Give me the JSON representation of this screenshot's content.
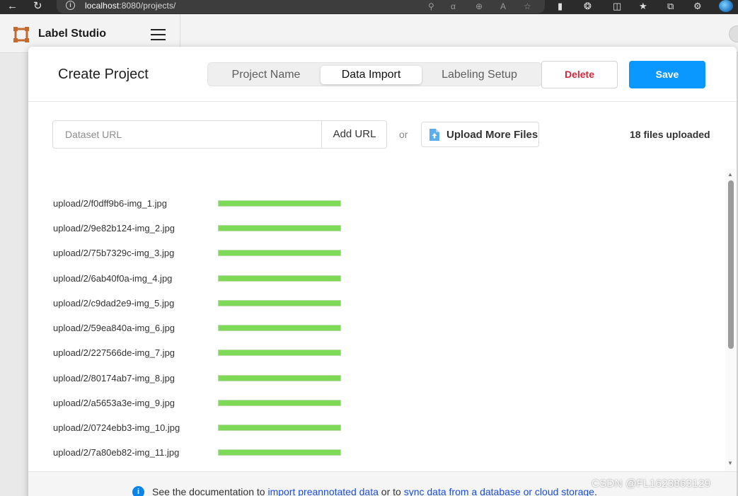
{
  "browser": {
    "back_icon": "back-arrow-icon",
    "reload_icon": "reload-icon",
    "url_host": "localhost",
    "url_path": ":8080/projects/"
  },
  "app": {
    "name": "Label Studio",
    "logo_color": "#c46a2e"
  },
  "modal": {
    "title": "Create Project",
    "tabs": [
      {
        "label": "Project Name",
        "active": false
      },
      {
        "label": "Data Import",
        "active": true
      },
      {
        "label": "Labeling Setup",
        "active": false
      }
    ],
    "delete_label": "Delete",
    "save_label": "Save",
    "accent_color": "#0a98ff",
    "delete_color": "#d9263c"
  },
  "import": {
    "url_placeholder": "Dataset URL",
    "add_url_label": "Add URL",
    "or_text": "or",
    "upload_label": "Upload More Files",
    "files_uploaded": "18 files uploaded"
  },
  "files": [
    {
      "name": "upload/2/f0dff9b6-img_1.jpg",
      "progress": 1.0
    },
    {
      "name": "upload/2/9e82b124-img_2.jpg",
      "progress": 1.0
    },
    {
      "name": "upload/2/75b7329c-img_3.jpg",
      "progress": 1.0
    },
    {
      "name": "upload/2/6ab40f0a-img_4.jpg",
      "progress": 1.0
    },
    {
      "name": "upload/2/c9dad2e9-img_5.jpg",
      "progress": 1.0
    },
    {
      "name": "upload/2/59ea840a-img_6.jpg",
      "progress": 1.0
    },
    {
      "name": "upload/2/227566de-img_7.jpg",
      "progress": 1.0
    },
    {
      "name": "upload/2/80174ab7-img_8.jpg",
      "progress": 1.0
    },
    {
      "name": "upload/2/a5653a3e-img_9.jpg",
      "progress": 1.0
    },
    {
      "name": "upload/2/0724ebb3-img_10.jpg",
      "progress": 1.0
    },
    {
      "name": "upload/2/7a80eb82-img_11.jpg",
      "progress": 1.0
    }
  ],
  "footer": {
    "prefix": "See the documentation to ",
    "link1": "import preannotated data",
    "middle": " or to ",
    "link2": "sync data from a database or cloud storage",
    "suffix": "."
  },
  "watermark": "CSDN @FL1623863129"
}
